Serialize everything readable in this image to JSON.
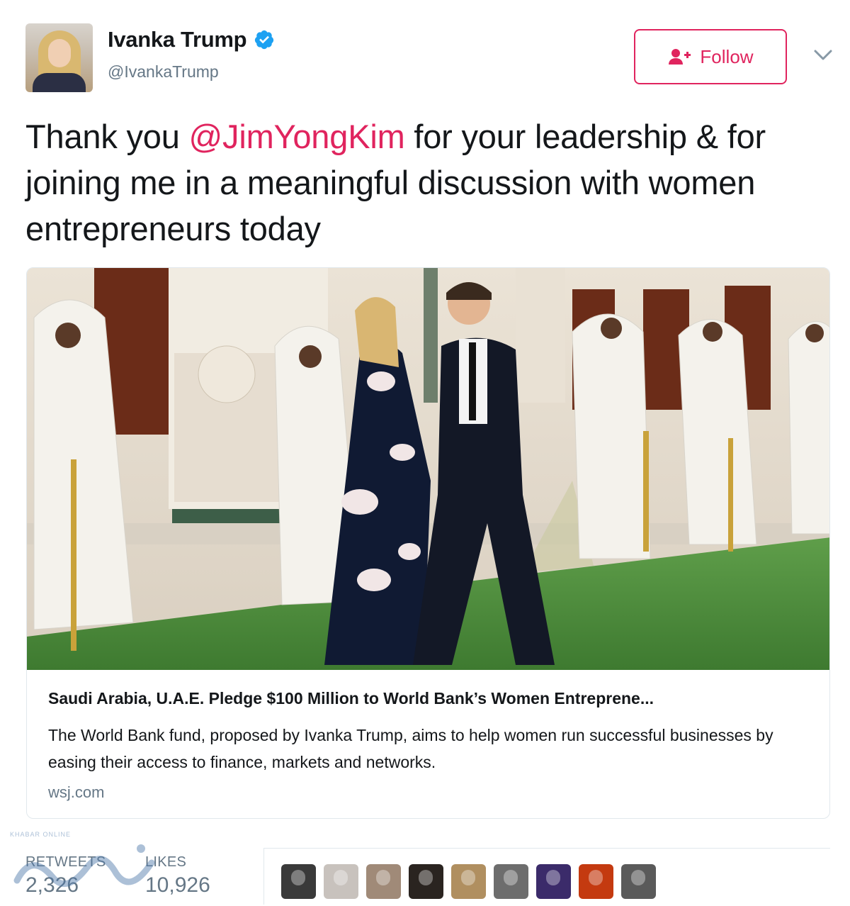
{
  "author": {
    "name": "Ivanka Trump",
    "handle": "@IvankaTrump",
    "verified_icon": "verified-badge-icon"
  },
  "follow_button": {
    "label": "Follow",
    "icon": "add-user-icon",
    "color": "#e0245e"
  },
  "menu": {
    "icon": "chevron-down-icon"
  },
  "tweet": {
    "text_before": "Thank you ",
    "mention": "@JimYongKim",
    "text_after": " for your leadership & for joining me in a meaningful discussion with women entrepreneurs today"
  },
  "card": {
    "title": "Saudi Arabia, U.A.E. Pledge $100 Million to World Bank’s Women Entreprene...",
    "description": "The World Bank fund, proposed by Ivanka Trump, aims to help women run successful businesses by easing their access to finance, markets and networks.",
    "domain": "wsj.com"
  },
  "stats": {
    "retweets_label": "RETWEETS",
    "retweets_value": "2,326",
    "likes_label": "LIKES",
    "likes_value": "10,926"
  },
  "watermark": {
    "small_text": "KHABAR ONLINE"
  },
  "likers": [
    {
      "name": "liker-1",
      "color": "#3a3a3a"
    },
    {
      "name": "liker-2",
      "color": "#c8c2bd"
    },
    {
      "name": "liker-3",
      "color": "#a08a78"
    },
    {
      "name": "liker-4",
      "color": "#2a2420"
    },
    {
      "name": "liker-5",
      "color": "#b08f60"
    },
    {
      "name": "liker-6",
      "color": "#6d6d6d"
    },
    {
      "name": "liker-7",
      "color": "#3b2b6a"
    },
    {
      "name": "liker-8",
      "color": "#c43a10"
    },
    {
      "name": "liker-9",
      "color": "#5a5a5a"
    }
  ]
}
